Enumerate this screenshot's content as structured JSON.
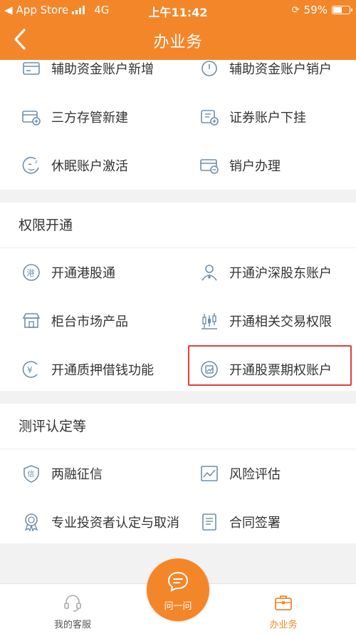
{
  "status_bar": {
    "carrier": "App Store",
    "network": "4G",
    "time": "上午11:42",
    "battery": "59%",
    "battery_level": 0.59
  },
  "nav": {
    "title": "办业务",
    "back_icon": "chevron-left-icon"
  },
  "colors": {
    "accent": "#f4862a",
    "highlight": "#e63c3c",
    "icon": "#6f8fa8"
  },
  "account_items": [
    {
      "label": "辅助资金账户新增",
      "icon": "card-plus-icon"
    },
    {
      "label": "辅助资金账户销户",
      "icon": "card-minus-icon"
    },
    {
      "label": "三方存管新建",
      "icon": "bank-card-add-icon"
    },
    {
      "label": "证券账户下挂",
      "icon": "securities-link-icon"
    },
    {
      "label": "休眠账户激活",
      "icon": "sleep-face-icon"
    },
    {
      "label": "销户办理",
      "icon": "card-cancel-icon"
    }
  ],
  "permissions": {
    "title": "权限开通",
    "items": [
      {
        "label": "开通港股通",
        "icon": "hk-badge-icon"
      },
      {
        "label": "开通沪深股东账户",
        "icon": "person-icon"
      },
      {
        "label": "柜台市场产品",
        "icon": "store-icon"
      },
      {
        "label": "开通相关交易权限",
        "icon": "candlestick-icon"
      },
      {
        "label": "开通质押借钱功能",
        "icon": "yen-coin-icon"
      },
      {
        "label": "开通股票期权账户",
        "icon": "option-chart-icon"
      }
    ]
  },
  "assessment": {
    "title": "测评认定等",
    "items": [
      {
        "label": "两融征信",
        "icon": "credit-shield-icon"
      },
      {
        "label": "风险评估",
        "icon": "risk-chart-icon"
      },
      {
        "label": "专业投资者认定与取消",
        "icon": "award-badge-icon"
      },
      {
        "label": "合同签署",
        "icon": "document-icon"
      }
    ]
  },
  "tab_bar": {
    "left": {
      "label": "我的客服",
      "icon": "headset-icon"
    },
    "center": {
      "label": "问一问",
      "icon": "chat-bubble-icon"
    },
    "right": {
      "label": "办业务",
      "icon": "briefcase-icon"
    }
  }
}
